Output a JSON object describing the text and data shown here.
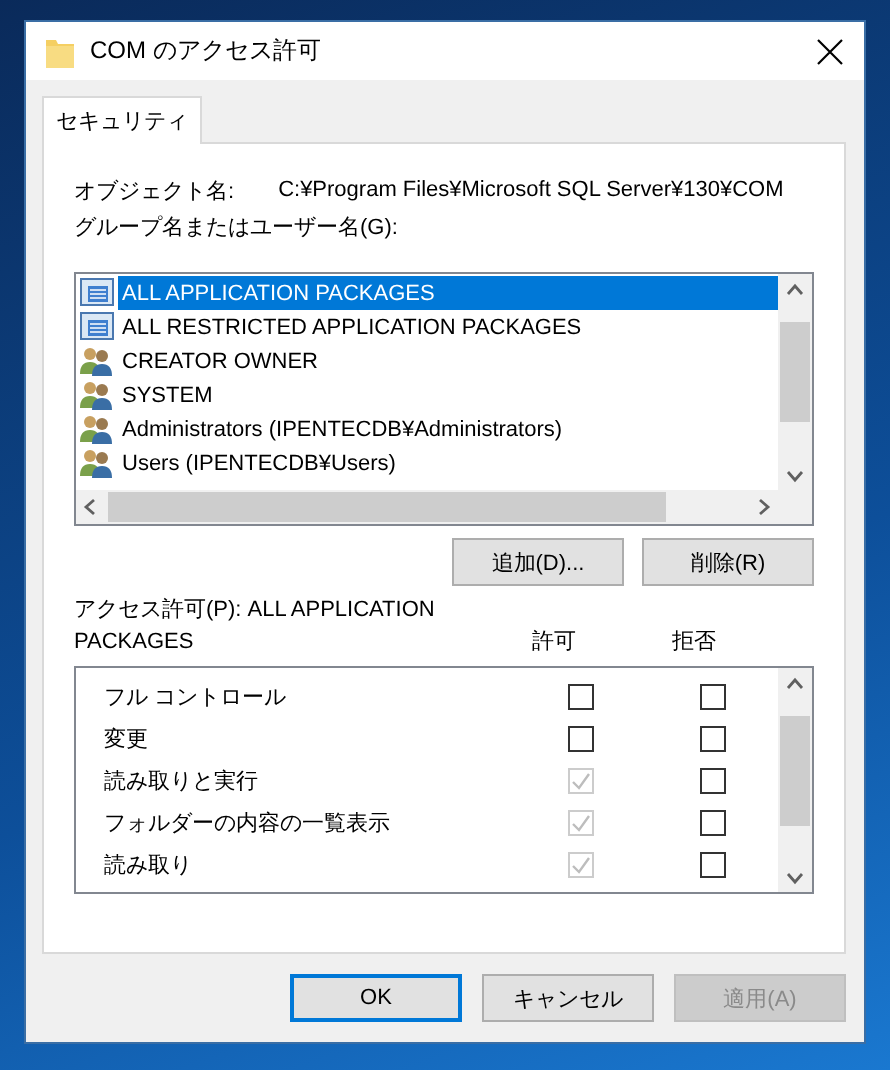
{
  "window": {
    "title": "COM のアクセス許可"
  },
  "tabs": [
    {
      "label": "セキュリティ",
      "selected": true
    }
  ],
  "object_name": {
    "label": "オブジェクト名:",
    "value": "C:¥Program Files¥Microsoft SQL Server¥130¥COM"
  },
  "users_label": "グループ名またはユーザー名(G):",
  "users": [
    {
      "kind": "package",
      "name": "ALL APPLICATION PACKAGES",
      "selected": true
    },
    {
      "kind": "package",
      "name": "ALL RESTRICTED APPLICATION PACKAGES",
      "selected": false
    },
    {
      "kind": "group",
      "name": "CREATOR OWNER",
      "selected": false
    },
    {
      "kind": "group",
      "name": "SYSTEM",
      "selected": false
    },
    {
      "kind": "group",
      "name": "Administrators (IPENTECDB¥Administrators)",
      "selected": false
    },
    {
      "kind": "group",
      "name": "Users (IPENTECDB¥Users)",
      "selected": false
    }
  ],
  "user_buttons": [
    "追加(D)...",
    "削除(R)"
  ],
  "permissions_label": "アクセス許可(P): ALL APPLICATION PACKAGES",
  "columns": [
    "許可",
    "拒否"
  ],
  "permissions": [
    {
      "name": "フル コントロール",
      "allow": {
        "checked": false,
        "disabled": false
      },
      "deny": {
        "checked": false,
        "disabled": false
      }
    },
    {
      "name": "変更",
      "allow": {
        "checked": false,
        "disabled": false
      },
      "deny": {
        "checked": false,
        "disabled": false
      }
    },
    {
      "name": "読み取りと実行",
      "allow": {
        "checked": true,
        "disabled": true
      },
      "deny": {
        "checked": false,
        "disabled": false
      }
    },
    {
      "name": "フォルダーの内容の一覧表示",
      "allow": {
        "checked": true,
        "disabled": true
      },
      "deny": {
        "checked": false,
        "disabled": false
      }
    },
    {
      "name": "読み取り",
      "allow": {
        "checked": true,
        "disabled": true
      },
      "deny": {
        "checked": false,
        "disabled": false
      }
    }
  ],
  "buttons": [
    {
      "label": "OK",
      "kind": "default",
      "disabled": false
    },
    {
      "label": "キャンセル",
      "kind": "normal",
      "disabled": false
    },
    {
      "label": "適用(A)",
      "kind": "normal",
      "disabled": true
    }
  ]
}
